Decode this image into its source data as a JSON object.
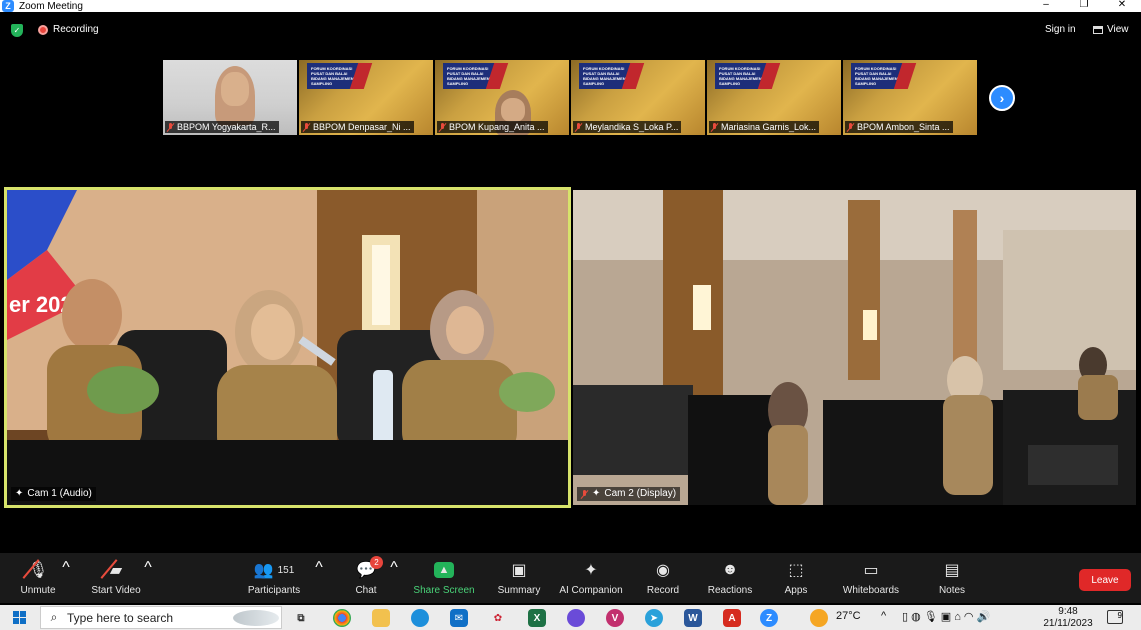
{
  "window": {
    "title": "Zoom Meeting",
    "controls": [
      "–",
      "❐",
      "✕"
    ]
  },
  "meeting_bar": {
    "recording_label": "Recording",
    "sign_in_label": "Sign in",
    "view_label": "View"
  },
  "thumbnails": [
    {
      "name": "BBPOM Yogyakarta_R...",
      "kind": "person"
    },
    {
      "name": "BBPOM Denpasar_Ni ...",
      "kind": "slide"
    },
    {
      "name": "BPOM Kupang_Anita ...",
      "kind": "slide-person"
    },
    {
      "name": "Meylandika S_Loka P...",
      "kind": "slide"
    },
    {
      "name": "Mariasina Garnis_Lok...",
      "kind": "slide"
    },
    {
      "name": "BPOM Ambon_Sinta ...",
      "kind": "slide"
    }
  ],
  "slide_banner_text": "FORUM KOORDINASI PUSAT DAN BALAI BIDANG MANAJEMEN SAMPLING",
  "tiles": {
    "main_left": {
      "label": "Cam 1 (Audio)",
      "overlay_text": "er 202"
    },
    "main_right": {
      "label": "Cam 2 (Display)"
    }
  },
  "toolbar": {
    "unmute": "Unmute",
    "start_video": "Start Video",
    "participants": "Participants",
    "participants_count": "151",
    "chat": "Chat",
    "chat_badge": "2",
    "share_screen": "Share Screen",
    "summary": "Summary",
    "ai_companion": "AI Companion",
    "record": "Record",
    "reactions": "Reactions",
    "apps": "Apps",
    "whiteboards": "Whiteboards",
    "notes": "Notes",
    "leave": "Leave"
  },
  "taskbar": {
    "search_placeholder": "Type here to search",
    "weather": "27°C",
    "time": "9:48",
    "date": "21/11/2023",
    "notification_count": "9"
  },
  "colors": {
    "zoom_blue": "#2d8cff",
    "share_green": "#23b35a",
    "leave_red": "#e02828",
    "active_speaker": "#d7e36b"
  }
}
